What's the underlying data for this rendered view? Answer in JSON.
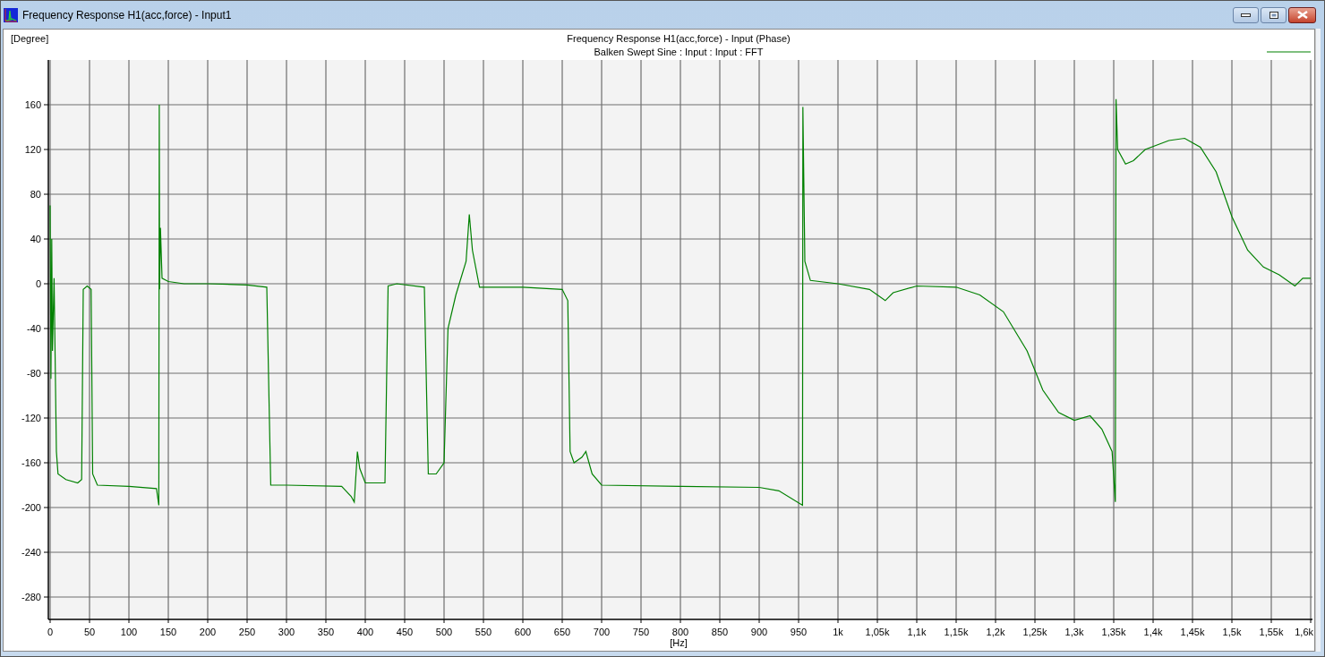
{
  "window": {
    "title": "Frequency Response H1(acc,force) - Input1"
  },
  "plot": {
    "subtitle": "Balken Swept Sine : Input : Input : FFT",
    "chart_data": {
      "type": "line",
      "grid": true,
      "title": "Frequency Response H1(acc,force) - Input (Phase)",
      "xlabel": "[Hz]",
      "ylabel": "[Degree]",
      "xlim": [
        0,
        1600
      ],
      "ylim": [
        -300,
        200
      ],
      "yticks": [
        160,
        120,
        80,
        40,
        0,
        -40,
        -80,
        -120,
        -160,
        -200,
        -240,
        -280
      ],
      "xticks": [
        0,
        50,
        100,
        150,
        200,
        250,
        300,
        350,
        400,
        450,
        500,
        550,
        600,
        650,
        700,
        750,
        800,
        850,
        900,
        950,
        {
          "value": 1000,
          "label": "1k"
        },
        {
          "value": 1050,
          "label": "1,05k"
        },
        {
          "value": 1100,
          "label": "1,1k"
        },
        {
          "value": 1150,
          "label": "1,15k"
        },
        {
          "value": 1200,
          "label": "1,2k"
        },
        {
          "value": 1250,
          "label": "1,25k"
        },
        {
          "value": 1300,
          "label": "1,3k"
        },
        {
          "value": 1350,
          "label": "1,35k"
        },
        {
          "value": 1400,
          "label": "1,4k"
        },
        {
          "value": 1450,
          "label": "1,45k"
        },
        {
          "value": 1500,
          "label": "1,5k"
        },
        {
          "value": 1550,
          "label": "1,55k"
        },
        {
          "value": 1600,
          "label": "1,6k"
        }
      ],
      "x": [
        0,
        1,
        2,
        3,
        5,
        8,
        10,
        20,
        35,
        40,
        42,
        47,
        52,
        54,
        60,
        100,
        135,
        138,
        138.5,
        139,
        140,
        142,
        150,
        170,
        200,
        250,
        275,
        280,
        300,
        370,
        382,
        386,
        390,
        393,
        400,
        425,
        429,
        440,
        475,
        480,
        490,
        500,
        505,
        515,
        528,
        532,
        536,
        545,
        600,
        650,
        657,
        660,
        665,
        675,
        680,
        688,
        700,
        800,
        900,
        925,
        955,
        955.5,
        958,
        965,
        1000,
        1040,
        1060,
        1070,
        1100,
        1150,
        1180,
        1210,
        1240,
        1260,
        1280,
        1300,
        1320,
        1335,
        1348,
        1352,
        1353,
        1355,
        1365,
        1375,
        1390,
        1420,
        1440,
        1460,
        1480,
        1500,
        1520,
        1540,
        1560,
        1580,
        1590,
        1600
      ],
      "series": [
        {
          "color": "#008000",
          "values": [
            70,
            -85,
            40,
            -60,
            5,
            -150,
            -170,
            -175,
            -178,
            -175,
            -5,
            -2,
            -5,
            -170,
            -180,
            -181,
            -183,
            -198,
            160,
            -5,
            50,
            5,
            2,
            0,
            0,
            -1,
            -3,
            -180,
            -180,
            -181,
            -190,
            -195,
            -150,
            -165,
            -178,
            -178,
            -2,
            0,
            -3,
            -170,
            -170,
            -160,
            -40,
            -10,
            20,
            62,
            30,
            -3,
            -3,
            -5,
            -15,
            -150,
            -160,
            -155,
            -150,
            -170,
            -180,
            -181,
            -182,
            -185,
            -198,
            158,
            20,
            3,
            0,
            -5,
            -15,
            -8,
            -2,
            -3,
            -10,
            -25,
            -60,
            -95,
            -115,
            -122,
            -118,
            -130,
            -150,
            -195,
            165,
            120,
            107,
            110,
            120,
            128,
            130,
            122,
            100,
            60,
            30,
            15,
            8,
            -2,
            5,
            5
          ]
        }
      ]
    }
  }
}
